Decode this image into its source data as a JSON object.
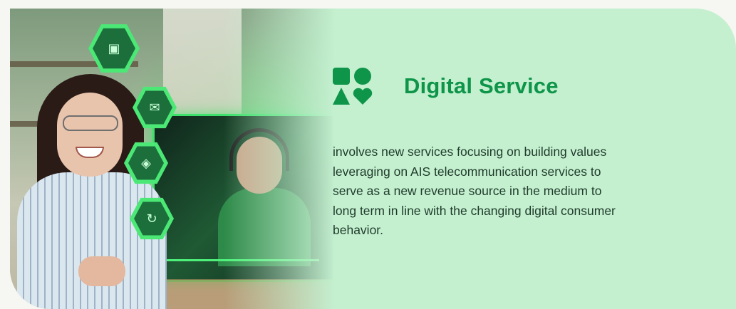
{
  "section": {
    "title": "Digital Service",
    "description": "involves new services focusing on building values leveraging on AIS telecommunication services to serve as a new revenue source in the medium to long term in line with the changing digital consumer behavior.",
    "icon": "shapes-icon"
  },
  "photo": {
    "alt_icons": [
      "camera-icon",
      "message-icon",
      "shield-icon",
      "sync-icon"
    ]
  },
  "colors": {
    "card_bg": "#c4f0d0",
    "accent": "#0e9549",
    "text": "#1f3a2a"
  }
}
